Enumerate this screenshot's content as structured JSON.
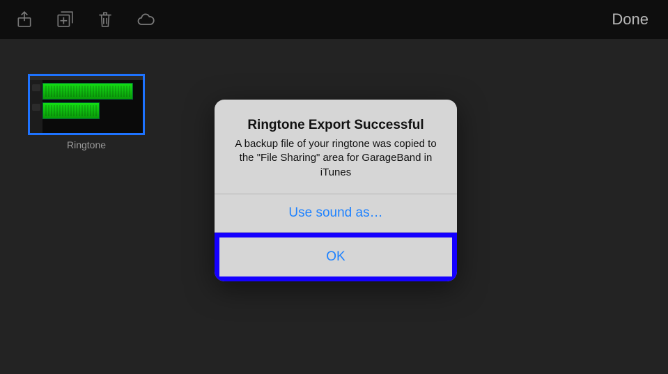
{
  "toolbar": {
    "done_label": "Done"
  },
  "song": {
    "name": "Ringtone"
  },
  "alert": {
    "title": "Ringtone Export Successful",
    "message": "A backup file of your ringtone was copied to the \"File Sharing\" area for GarageBand in iTunes",
    "use_sound_as_label": "Use sound as…",
    "ok_label": "OK"
  }
}
